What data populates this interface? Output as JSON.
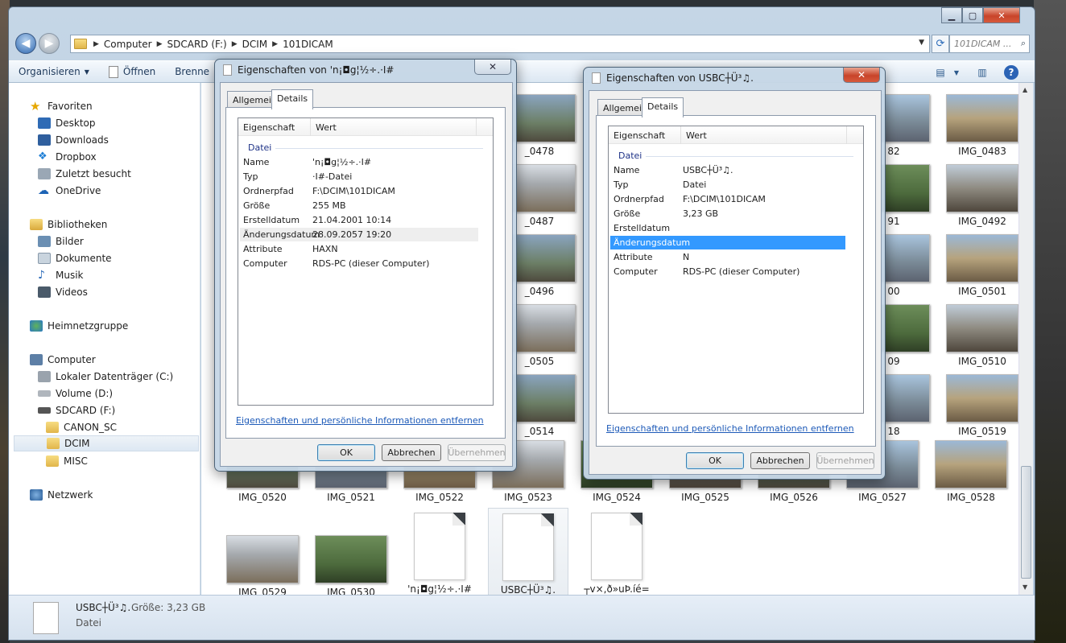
{
  "explorer": {
    "address": [
      "Computer",
      "SDCARD (F:)",
      "DCIM",
      "101DICAM"
    ],
    "search_placeholder": "101DICAM ...",
    "toolbar": {
      "organize": "Organisieren",
      "open": "Öffnen",
      "burn": "Brenne"
    },
    "window_controls": {
      "minimize": "▁",
      "maximize": "▢",
      "close": "✕"
    }
  },
  "nav": {
    "favorites": "Favoriten",
    "desktop": "Desktop",
    "downloads": "Downloads",
    "dropbox": "Dropbox",
    "recent": "Zuletzt besucht",
    "onedrive": "OneDrive",
    "libraries": "Bibliotheken",
    "pictures": "Bilder",
    "documents": "Dokumente",
    "music": "Musik",
    "videos": "Videos",
    "homegroup": "Heimnetzgruppe",
    "computer": "Computer",
    "drive_c": "Lokaler Datenträger (C:)",
    "drive_d": "Volume (D:)",
    "drive_f": "SDCARD (F:)",
    "canon": "CANON_SC",
    "dcim": "DCIM",
    "misc": "MISC",
    "network": "Netzwerk"
  },
  "thumbs": [
    {
      "label": "_0478"
    },
    {
      "label": "82"
    },
    {
      "label": "IMG_0483"
    },
    {
      "label": "_0487"
    },
    {
      "label": "91"
    },
    {
      "label": "IMG_0492"
    },
    {
      "label": "_0496"
    },
    {
      "label": "00"
    },
    {
      "label": "IMG_0501"
    },
    {
      "label": "_0505"
    },
    {
      "label": "09"
    },
    {
      "label": "IMG_0510"
    },
    {
      "label": "_0514"
    },
    {
      "label": "18"
    },
    {
      "label": "IMG_0519"
    },
    {
      "label": "IMG_0520"
    },
    {
      "label": "IMG_0521"
    },
    {
      "label": "IMG_0522"
    },
    {
      "label": "IMG_0523"
    },
    {
      "label": "IMG_0524"
    },
    {
      "label": "IMG_0525"
    },
    {
      "label": "IMG_0526"
    },
    {
      "label": "IMG_0527"
    },
    {
      "label": "IMG_0528"
    },
    {
      "label": "IMG_0529"
    },
    {
      "label": "IMG_0530"
    }
  ],
  "files": [
    {
      "label": "'n¡◘g¦½÷.·I#"
    },
    {
      "label": "USBC┼Ü³♫."
    },
    {
      "label": "┬v×,ð»uÞ.íé="
    }
  ],
  "status": {
    "name": "USBC┼Ü³♫.",
    "size": "Größe: 3,23 GB",
    "type": "Datei"
  },
  "dialog1": {
    "title": "Eigenschaften von 'n¡◘g¦½÷.·I#",
    "tabs": [
      "Allgemein",
      "Details"
    ],
    "col_property": "Eigenschaft",
    "col_value": "Wert",
    "group": "Datei",
    "rows": [
      {
        "k": "Name",
        "v": "'n¡◘g¦½÷.·I#"
      },
      {
        "k": "Typ",
        "v": "·I#-Datei"
      },
      {
        "k": "Ordnerpfad",
        "v": "F:\\DCIM\\101DICAM"
      },
      {
        "k": "Größe",
        "v": "255 MB"
      },
      {
        "k": "Erstelldatum",
        "v": "21.04.2001 10:14"
      },
      {
        "k": "Änderungsdatum",
        "v": "28.09.2057 19:20"
      },
      {
        "k": "Attribute",
        "v": "HAXN"
      },
      {
        "k": "Computer",
        "v": "RDS-PC (dieser Computer)"
      }
    ],
    "link": "Eigenschaften und persönliche Informationen entfernen",
    "ok": "OK",
    "cancel": "Abbrechen",
    "apply": "Übernehmen"
  },
  "dialog2": {
    "title": "Eigenschaften von USBC┼Ü³♫.",
    "tabs": [
      "Allgemein",
      "Details"
    ],
    "col_property": "Eigenschaft",
    "col_value": "Wert",
    "group": "Datei",
    "rows": [
      {
        "k": "Name",
        "v": "USBC┼Ü³♫."
      },
      {
        "k": "Typ",
        "v": "Datei"
      },
      {
        "k": "Ordnerpfad",
        "v": "F:\\DCIM\\101DICAM"
      },
      {
        "k": "Größe",
        "v": "3,23 GB"
      },
      {
        "k": "Erstelldatum",
        "v": ""
      },
      {
        "k": "Änderungsdatum",
        "v": ""
      },
      {
        "k": "Attribute",
        "v": "N"
      },
      {
        "k": "Computer",
        "v": "RDS-PC (dieser Computer)"
      }
    ],
    "link": "Eigenschaften und persönliche Informationen entfernen",
    "ok": "OK",
    "cancel": "Abbrechen",
    "apply": "Übernehmen"
  },
  "colors": {
    "selection": "#3399ff",
    "link": "#1d5ab8",
    "group_header": "#1e3287"
  }
}
